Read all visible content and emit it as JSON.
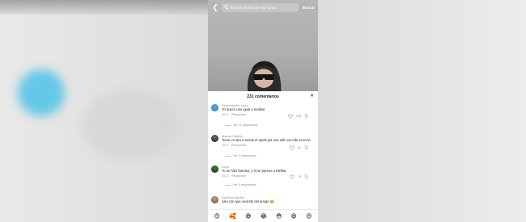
{
  "search": {
    "back_icon": "back-arrow-icon",
    "query": "Yo todo el día con esta canci...",
    "button_label": "Buscar"
  },
  "comments_panel": {
    "title": "231 comentarios",
    "close_icon": "close-icon",
    "comments": [
      {
        "username": "Sxxxxxxxxxx xxxxx",
        "text": "Yo busco uno igual a melitos",
        "date": "10-3",
        "reply_label": "Responder",
        "likes": "248",
        "view_replies": "Ver 11 respuestas"
      },
      {
        "username": "Marian Castillo",
        "text": "Tiene vn aire a melos el quizá por eso salí con ella JAJAJA",
        "date": "10-3",
        "reply_label": "Responder",
        "likes": "61",
        "view_replies": "Ver 2 respuestas"
      },
      {
        "username": "Luyix",
        "text": "Yo se hizo famoso, y él se parece a Melisa",
        "date": "10-3",
        "reply_label": "Responder",
        "likes": "76",
        "view_replies": "Ver 5 respuestas"
      },
      {
        "username": "Gabriela Aguilar",
        "text": "Like con que vecinito del amigo 😂"
      }
    ]
  },
  "emoji_bar": [
    "😊",
    "🥰",
    "😅",
    "😂",
    "😳",
    "😆",
    "😍"
  ]
}
